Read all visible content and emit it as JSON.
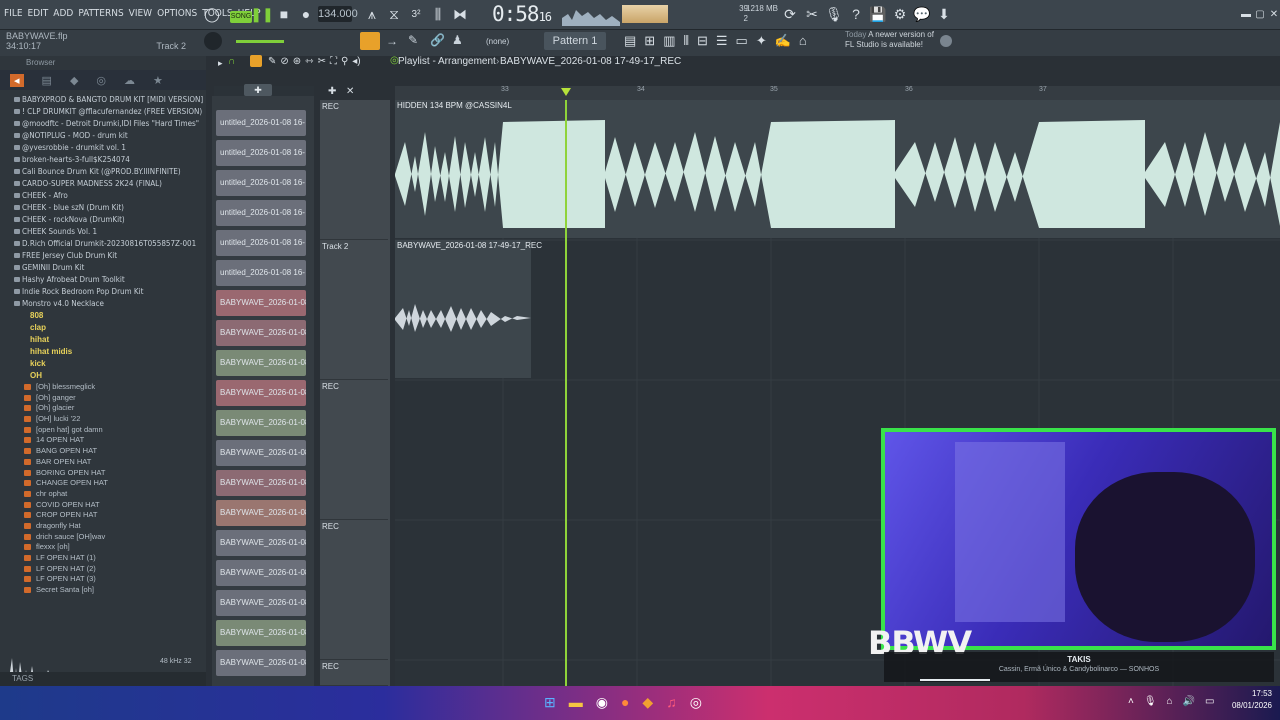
{
  "menu": [
    "FILE",
    "EDIT",
    "ADD",
    "PATTERNS",
    "VIEW",
    "OPTIONS",
    "TOOLS",
    "HELP"
  ],
  "transport": {
    "song_label": "SONG",
    "tempo": "134.000",
    "time": "0:58",
    "time_frac": "16",
    "mem": "1218 MB",
    "cpu": "39",
    "poly": "2"
  },
  "project": {
    "file": "BABYWAVE.flp",
    "position": "34:10:17",
    "track": "Track 2"
  },
  "pattern": {
    "none": "(none)",
    "name": "Pattern 1"
  },
  "notice": {
    "today": "Today",
    "text": "A newer version of FL Studio is available!"
  },
  "browser": {
    "title": "Browser",
    "folders": [
      "BABYXPROD & BANGTO DRUM KIT [MIDI VERSION]",
      "! CLP DRUMKIT @fflacufernandez (FREE VERSION)",
      "@moodftc - Detroit Drumki,IDI Files \"Hard Times\"",
      "@NOTIPLUG - MOD - drum kit",
      "@yvesrobbie - drumkit vol. 1",
      "broken-hearts-3-full$K254074",
      "Cali Bounce Drum Kit (@PROD.BY.IIINFINITE)",
      "CARDO-SUPER MADNESS 2K24 (FINAL)",
      "CHEEK - Afro",
      "CHEEK - blue szN (Drum Kit)",
      "CHEEK - rockNova (DrumKit)",
      "CHEEK Sounds Vol. 1",
      "D.Rich Official Drumkit-20230816T055857Z-001",
      "FREE Jersey Club Drum Kit",
      "GEMINII Drum Kit",
      "Hashy Afrobeat Drum Toolkit",
      "Indie Rock Bedroom Pop Drum Kit",
      "Monstro v4.0 Necklace"
    ],
    "subfolders": [
      "808",
      "clap",
      "hihat",
      "hihat midis",
      "kick",
      "OH"
    ],
    "files": [
      "[Oh] blessmeglick",
      "[Oh] ganger",
      "[Oh] glacier",
      "[OH] lucki '22",
      "[open hat] got damn",
      "14 OPEN HAT",
      "BANG OPEN HAT",
      "BAR OPEN HAT",
      "BORING OPEN HAT",
      "CHANGE OPEN HAT",
      "chr ophat",
      "COVID OPEN HAT",
      "CROP OPEN HAT",
      "dragonfly Hat",
      "drich sauce [OH]wav",
      "flexxx [oh]",
      "LF OPEN HAT (1)",
      "LF OPEN HAT (2)",
      "LF OPEN HAT (3)",
      "Secret Santa [oh]"
    ],
    "sample_rate": "48 kHz 32",
    "tags": "TAGS"
  },
  "playlist": {
    "title": "Playlist - Arrangement",
    "breadcrumb": "BABYWAVE_2026-01-08 17-49-17_REC",
    "ruler": [
      "33",
      "34",
      "35",
      "36",
      "37"
    ],
    "clips": [
      "untitled_2026-01-08 16-",
      "untitled_2026-01-08 16-",
      "untitled_2026-01-08 16-",
      "untitled_2026-01-08 16-",
      "untitled_2026-01-08 16-",
      "untitled_2026-01-08 16-",
      "BABYWAVE_2026-01-08 1",
      "BABYWAVE_2026-01-08 1",
      "BABYWAVE_2026-01-08 1",
      "BABYWAVE_2026-01-08 1",
      "BABYWAVE_2026-01-08 1",
      "BABYWAVE_2026-01-08 1",
      "BABYWAVE_2026-01-08 1",
      "BABYWAVE_2026-01-08 1",
      "BABYWAVE_2026-01-08 1",
      "BABYWAVE_2026-01-08 1",
      "BABYWAVE_2026-01-08 1",
      "BABYWAVE_2026-01-08 1",
      "BABYWAVE_2026-01-08 1"
    ],
    "tracks": [
      {
        "name": "REC",
        "clip": "HIDDEN 134 BPM @CASSIN4L"
      },
      {
        "name": "Track 2",
        "clip": "BABYWAVE_2026-01-08 17-49-17_REC"
      },
      {
        "name": "REC",
        "clip": ""
      },
      {
        "name": "REC",
        "clip": ""
      },
      {
        "name": "REC",
        "clip": ""
      }
    ]
  },
  "overlay": {
    "logo": "BBWV",
    "song": "TAKIS",
    "artist": "Cassin, Ermã Único & Candybolinarco — SONHOS"
  },
  "tray": {
    "time": "17:53",
    "date": "08/01/2026"
  }
}
